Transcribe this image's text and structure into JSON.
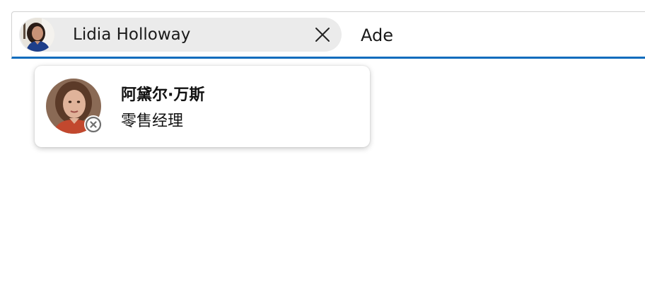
{
  "picker": {
    "selected_person": {
      "name": "Lidia Holloway",
      "avatar_icon": "person-avatar-photo"
    },
    "remove_icon": "dismiss-icon",
    "query_text": "Ade"
  },
  "suggestions": [
    {
      "name": "阿黛尔·万斯",
      "title": "零售经理",
      "avatar_icon": "person-avatar-photo",
      "presence_icon": "presence-offline-icon"
    }
  ],
  "colors": {
    "accent_underline": "#0f6cbd",
    "chip_background": "#ebebeb",
    "presence_gray": "#707070"
  }
}
